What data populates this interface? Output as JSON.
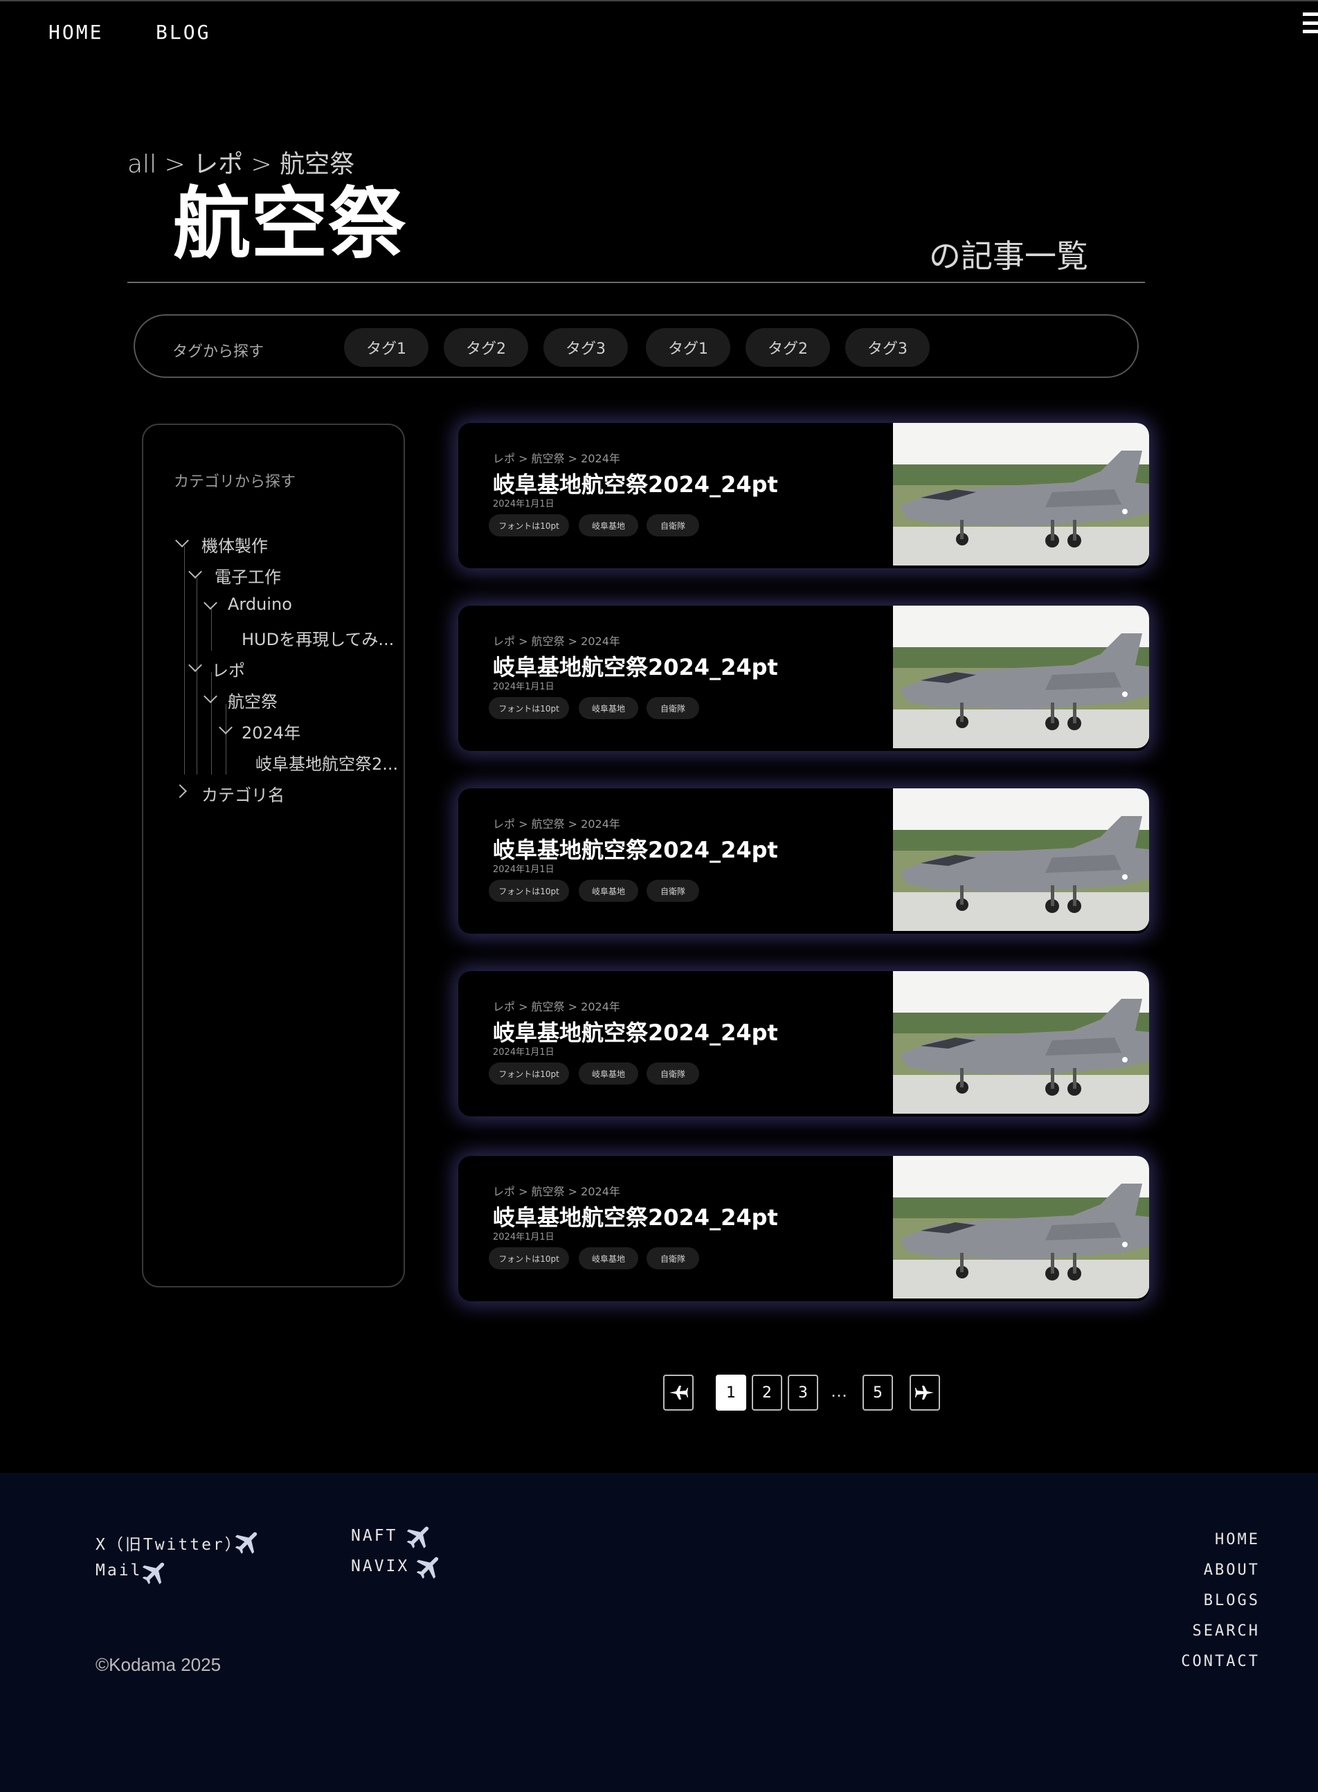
{
  "header": {
    "nav": [
      "HOME",
      "BLOG"
    ]
  },
  "title_area": {
    "breadcrumb": "all > レポ > 航空祭",
    "title": "航空祭",
    "subtitle": "の記事一覧"
  },
  "tagbar": {
    "label": "タグから探す",
    "tags": [
      "タグ1",
      "タグ2",
      "タグ3",
      "タグ1",
      "タグ2",
      "タグ3"
    ]
  },
  "sidebar": {
    "title": "カテゴリから探す",
    "tree": [
      {
        "label": "機体製作",
        "expanded": true
      },
      {
        "label": "電子工作",
        "expanded": true
      },
      {
        "label": "Arduino",
        "expanded": true
      },
      {
        "label": "HUDを再現してみ..."
      },
      {
        "label": "レポ",
        "expanded": true
      },
      {
        "label": "航空祭",
        "expanded": true
      },
      {
        "label": "2024年",
        "expanded": true
      },
      {
        "label": "岐阜基地航空祭2..."
      },
      {
        "label": "カテゴリ名",
        "expanded": false
      }
    ]
  },
  "articles": [
    {
      "crumb": "レポ > 航空祭 > 2024年",
      "title": "岐阜基地航空祭2024_24pt",
      "date": "2024年1月1日",
      "tags": [
        "フォントは10pt",
        "岐阜基地",
        "自衛隊"
      ]
    },
    {
      "crumb": "レポ > 航空祭 > 2024年",
      "title": "岐阜基地航空祭2024_24pt",
      "date": "2024年1月1日",
      "tags": [
        "フォントは10pt",
        "岐阜基地",
        "自衛隊"
      ]
    },
    {
      "crumb": "レポ > 航空祭 > 2024年",
      "title": "岐阜基地航空祭2024_24pt",
      "date": "2024年1月1日",
      "tags": [
        "フォントは10pt",
        "岐阜基地",
        "自衛隊"
      ]
    },
    {
      "crumb": "レポ > 航空祭 > 2024年",
      "title": "岐阜基地航空祭2024_24pt",
      "date": "2024年1月1日",
      "tags": [
        "フォントは10pt",
        "岐阜基地",
        "自衛隊"
      ]
    },
    {
      "crumb": "レポ > 航空祭 > 2024年",
      "title": "岐阜基地航空祭2024_24pt",
      "date": "2024年1月1日",
      "tags": [
        "フォントは10pt",
        "岐阜基地",
        "自衛隊"
      ]
    }
  ],
  "pagination": {
    "pages": [
      "1",
      "2",
      "3",
      "5"
    ],
    "ellipsis": "…",
    "current": "1"
  },
  "footer": {
    "left_links": [
      "X（旧Twitter）",
      "Mail"
    ],
    "mid_links": [
      "NAFT",
      "NAVIX"
    ],
    "right_links": [
      "HOME",
      "ABOUT",
      "BLOGS",
      "SEARCH",
      "CONTACT"
    ],
    "copyright": "©Kodama 2025"
  },
  "colors": {
    "background": "#000000",
    "footer": "#050b1c",
    "card_glow": "#5a50aa"
  }
}
